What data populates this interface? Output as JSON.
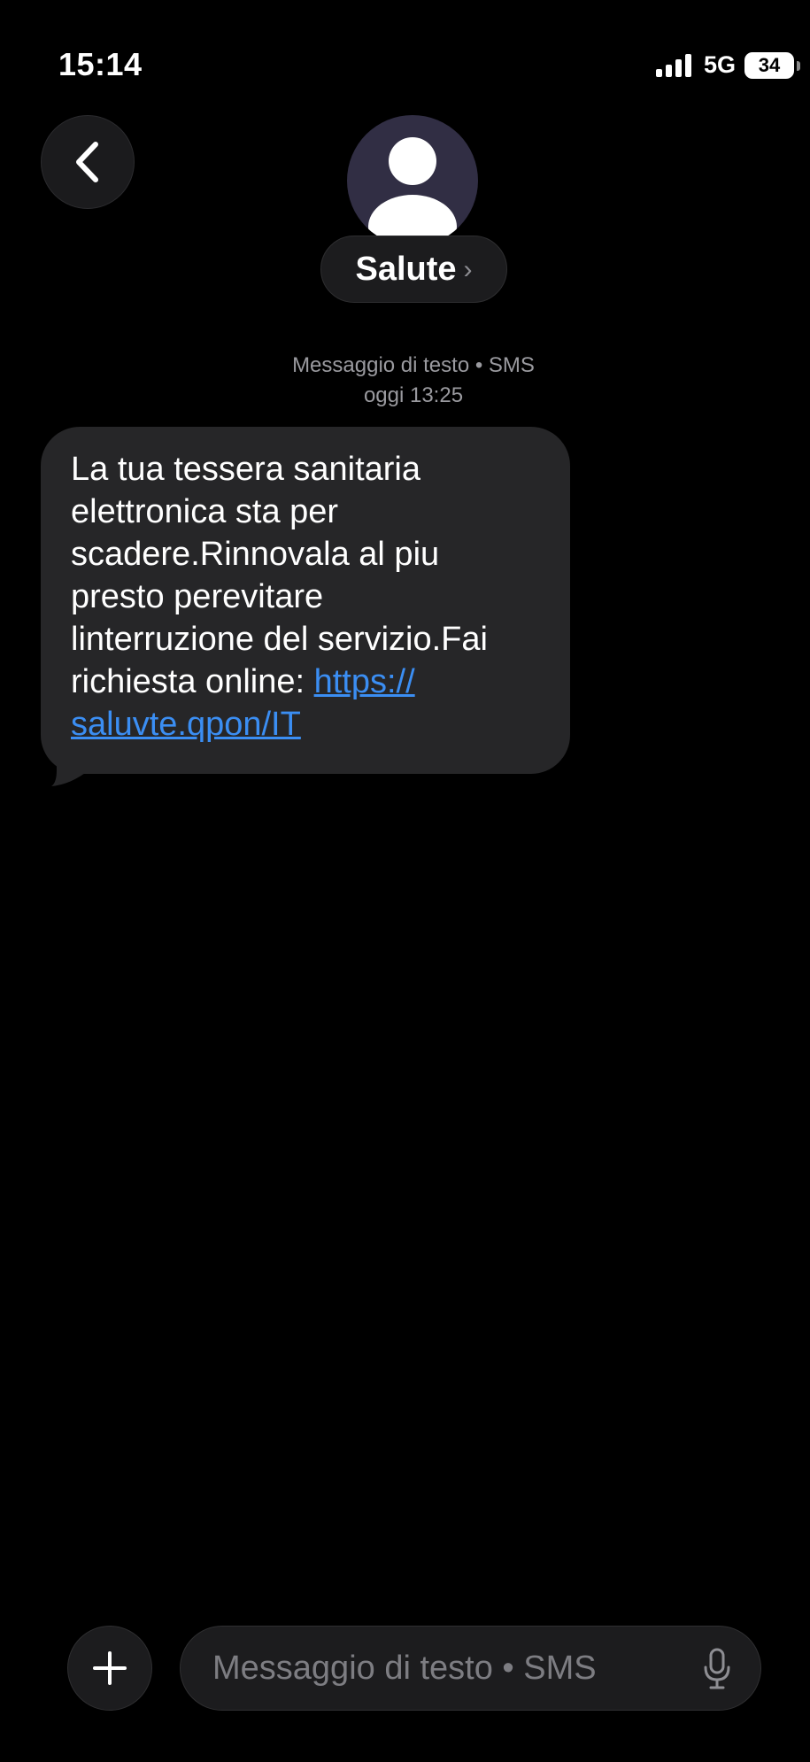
{
  "status_bar": {
    "time": "15:14",
    "network": "5G",
    "battery": "34"
  },
  "header": {
    "contact_name": "Salute",
    "chevron": "›"
  },
  "thread": {
    "meta_type": "Messaggio di testo • SMS",
    "meta_time": "oggi 13:25",
    "message": {
      "text": "La tua tessera sanitaria\nelettronica sta per\nscadere.Rinnovala al piu\npresto perevitare\nlinterruzione del servizio.Fai\nrichiesta online: ",
      "link_line1": "https://",
      "link_line2": "saluvte.qpon/IT"
    }
  },
  "composer": {
    "placeholder": "Messaggio di testo • SMS"
  },
  "icons": {
    "back": "chevron-left-icon",
    "avatar": "person-icon",
    "plus": "plus-icon",
    "mic": "microphone-icon",
    "signal": "cellular-signal-icon",
    "battery": "battery-icon"
  },
  "colors": {
    "background": "#000000",
    "bubble": "#262628",
    "link": "#3b8ef3",
    "muted_text": "#9a9a9f",
    "avatar_bg": "#312e44"
  }
}
